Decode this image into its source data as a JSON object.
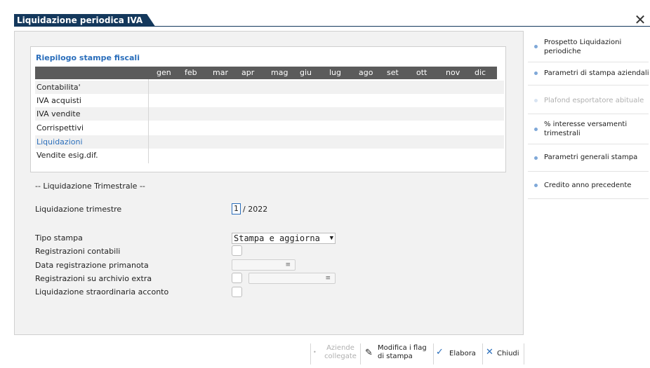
{
  "window": {
    "title": "Liquidazione periodica IVA",
    "close_icon": "close-icon"
  },
  "summary": {
    "title": "Riepilogo stampe fiscali",
    "months": [
      "gen",
      "feb",
      "mar",
      "apr",
      "mag",
      "giu",
      "lug",
      "ago",
      "set",
      "ott",
      "nov",
      "dic"
    ],
    "rows": [
      {
        "label": "Contabilita'",
        "highlight": false
      },
      {
        "label": "IVA acquisti",
        "highlight": false
      },
      {
        "label": "IVA vendite",
        "highlight": false
      },
      {
        "label": "Corrispettivi",
        "highlight": false
      },
      {
        "label": "Liquidazioni",
        "highlight": true
      },
      {
        "label": "Vendite esig.dif.",
        "highlight": false
      }
    ]
  },
  "section_title": "-- Liquidazione Trimestrale --",
  "form": {
    "trimestre_label": "Liquidazione trimestre",
    "trimestre_value": "1",
    "trimestre_year": "/ 2022",
    "tipo_stampa_label": "Tipo stampa",
    "tipo_stampa_value": "Stampa e aggiorna",
    "registrazioni_contabili_label": "Registrazioni contabili",
    "data_registrazione_label": "Data registrazione primanota",
    "registrazioni_extra_label": "Registrazioni su archivio extra",
    "straordinaria_label": "Liquidazione straordinaria acconto",
    "field_menu_glyph": "≡"
  },
  "side_menu": [
    {
      "label": "Prospetto Liquidazioni periodiche",
      "enabled": true
    },
    {
      "label": "Parametri di stampa aziendali",
      "enabled": true
    },
    {
      "label": "Plafond esportatore abituale",
      "enabled": false
    },
    {
      "label": "% interesse versamenti trimestrali",
      "enabled": true
    },
    {
      "label": "Parametri generali stampa",
      "enabled": true
    },
    {
      "label": "Credito anno precedente",
      "enabled": true
    }
  ],
  "toolbar": {
    "aziende_collegate": "Aziende collegate",
    "modifica_flag": "Modifica i flag di stampa",
    "elabora": "Elabora",
    "chiudi": "Chiudi"
  },
  "colors": {
    "title_bar": "#14385c",
    "accent_blue": "#2a6ebb",
    "grid_header": "#5b5b5b"
  }
}
